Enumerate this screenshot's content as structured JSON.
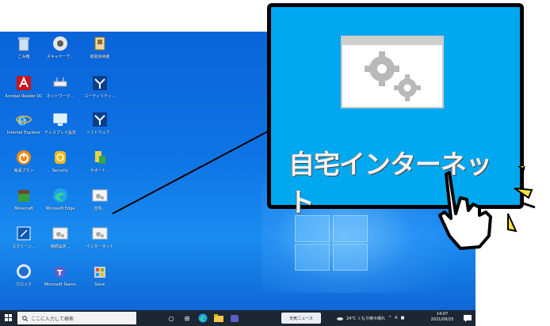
{
  "desktop": {
    "icons": [
      {
        "name": "recycle-bin-icon",
        "label": "ごみ箱"
      },
      {
        "name": "scanner-icon",
        "label": "スキャナーで..."
      },
      {
        "name": "folder-icon",
        "label": "取扱説明書"
      },
      {
        "name": "adobe-acrobat-icon",
        "label": "Acrobat Reader DC"
      },
      {
        "name": "network-device-icon",
        "label": "ネットワーク..."
      },
      {
        "name": "y-app-icon",
        "label": "ユーティリティ..."
      },
      {
        "name": "internet-explorer-icon",
        "label": "Internet Explorer"
      },
      {
        "name": "display-settings-icon",
        "label": "ディスプレイ設定"
      },
      {
        "name": "y-app-2-icon",
        "label": "ソフトウェア..."
      },
      {
        "name": "power-app-icon",
        "label": "電源プラン"
      },
      {
        "name": "security-app-icon",
        "label": "Security"
      },
      {
        "name": "tools-app-icon",
        "label": "サポート..."
      },
      {
        "name": "minecraft-icon",
        "label": "Minecraft"
      },
      {
        "name": "edge-icon",
        "label": "Microsoft Edge"
      },
      {
        "name": "settings-shortcut-icon",
        "label": "自宅..."
      },
      {
        "name": "tablet-app-icon",
        "label": "スクリーン..."
      },
      {
        "name": "gear-shortcut-icon",
        "label": "接続設定..."
      },
      {
        "name": "gear-shortcut-2-icon",
        "label": "インターネット"
      },
      {
        "name": "clock-app-icon",
        "label": "クロック"
      },
      {
        "name": "teams-icon",
        "label": "Microsoft Teams"
      },
      {
        "name": "store-icon",
        "label": "Store"
      }
    ]
  },
  "taskbar": {
    "search_placeholder": "ここに入力して検索",
    "news_label": "天気ニュース",
    "weather_text": "24°C くもり時々晴れ",
    "time": "14:07",
    "date": "2021/09/25"
  },
  "callout": {
    "title": "自宅インターネット"
  },
  "colors": {
    "desktop_blue": "#0f76e6",
    "callout_blue": "#00a8f0",
    "taskbar": "#1c2733"
  }
}
